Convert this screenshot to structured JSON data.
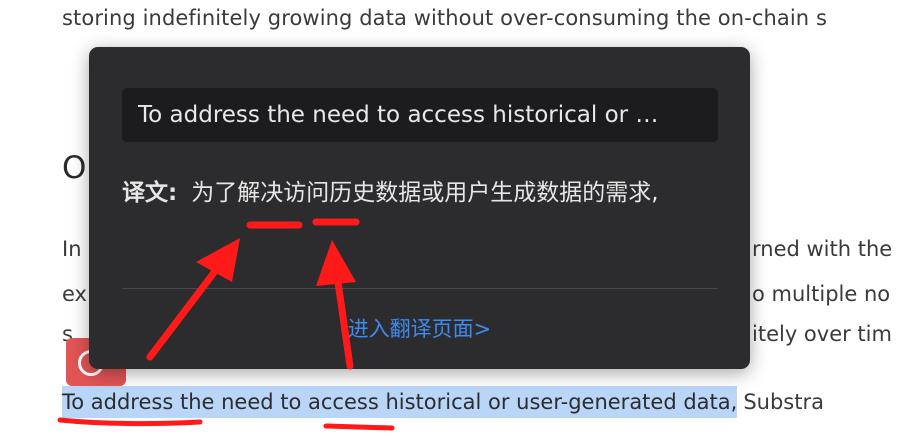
{
  "document": {
    "top_line": "storing indefinitely growing data without over-consuming the on-chain s",
    "heading_fragment": "O",
    "left_fragments": [
      "In",
      "ex",
      "s"
    ],
    "right_fragments": [
      "rned with the",
      "o multiple no",
      "itely over tim"
    ],
    "highlighted_text": "To address the need to access historical or user-generated data,",
    "after_highlight": "Substra"
  },
  "popup": {
    "source_text": "To address the need to access historical or …",
    "translation_label": "译文:",
    "translation_text": "为了解决访问历史数据或用户生成数据的需求,",
    "open_page_link": "进入翻译页面>"
  },
  "colors": {
    "popup_bg": "#2c2c2e",
    "source_bg": "#1c1c1e",
    "link": "#3d8bef",
    "highlight": "#b9d6f9",
    "annotation": "#ff1a1a"
  },
  "icons": {
    "app_badge": "translate-app-icon"
  }
}
